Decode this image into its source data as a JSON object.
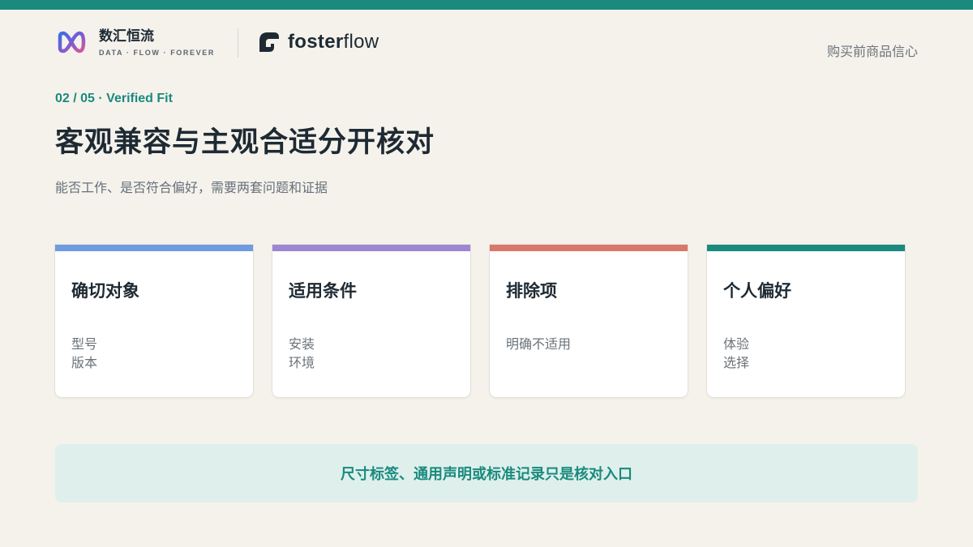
{
  "colors": {
    "accent": "#1a8a7e",
    "background": "#f5f2ec",
    "stripe_blue": "#6f9be0",
    "stripe_purple": "#9d86d2",
    "stripe_red": "#d9776a",
    "stripe_teal": "#1a8a7e"
  },
  "header": {
    "brand_name": "数汇恒流",
    "brand_tagline": "DATA · FLOW · FOREVER",
    "brand_logo_icon": "infinity-logo-icon",
    "partner_icon": "fosterflow-logo-icon",
    "partner_name_bold": "foster",
    "partner_name_light": "flow",
    "top_right": "购买前商品信心"
  },
  "slide": {
    "kicker": "02 / 05 · Verified Fit",
    "title": "客观兼容与主观合适分开核对",
    "subtitle": "能否工作、是否符合偏好，需要两套问题和证据"
  },
  "cards": [
    {
      "title": "确切对象",
      "lines": [
        "型号",
        "版本"
      ],
      "stripe": "#6f9be0"
    },
    {
      "title": "适用条件",
      "lines": [
        "安装",
        "环境"
      ],
      "stripe": "#9d86d2"
    },
    {
      "title": "排除项",
      "lines": [
        "明确不适用"
      ],
      "stripe": "#d9776a"
    },
    {
      "title": "个人偏好",
      "lines": [
        "体验",
        "选择"
      ],
      "stripe": "#1a8a7e"
    }
  ],
  "note": "尺寸标签、通用声明或标准记录只是核对入口"
}
